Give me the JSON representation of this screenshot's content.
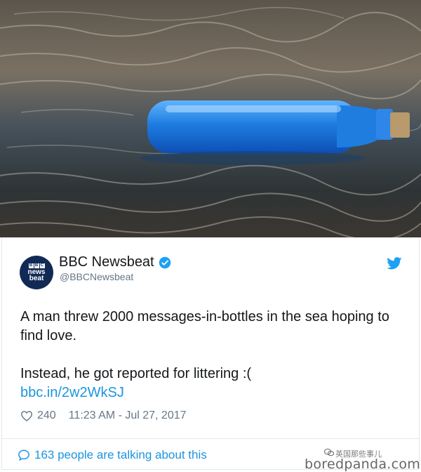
{
  "photo": {
    "subject": "blue-glass-bottle-in-water"
  },
  "tweet": {
    "display_name": "BBC Newsbeat",
    "handle": "@BBCNewsbeat",
    "avatar_lines": [
      "BBC",
      "news",
      "beat"
    ],
    "text_line1": "A man threw 2000 messages-in-bottles in the sea hoping to find love.",
    "text_line2": "Instead, he got reported for littering :(",
    "link": "bbc.in/2w2WkSJ",
    "likes": "240",
    "timestamp": "11:23 AM - Jul 27, 2017",
    "talking": "163 people are talking about this"
  },
  "icons": {
    "verified": "verified-badge-icon",
    "platform": "twitter-bird-icon",
    "like": "heart-icon",
    "reply": "speech-bubble-icon"
  },
  "colors": {
    "link_blue": "#1b95e0",
    "meta_gray": "#657786",
    "avatar_bg": "#112a55"
  },
  "watermark": {
    "cn": "英国那些事儿",
    "site": "boredpanda.com"
  }
}
